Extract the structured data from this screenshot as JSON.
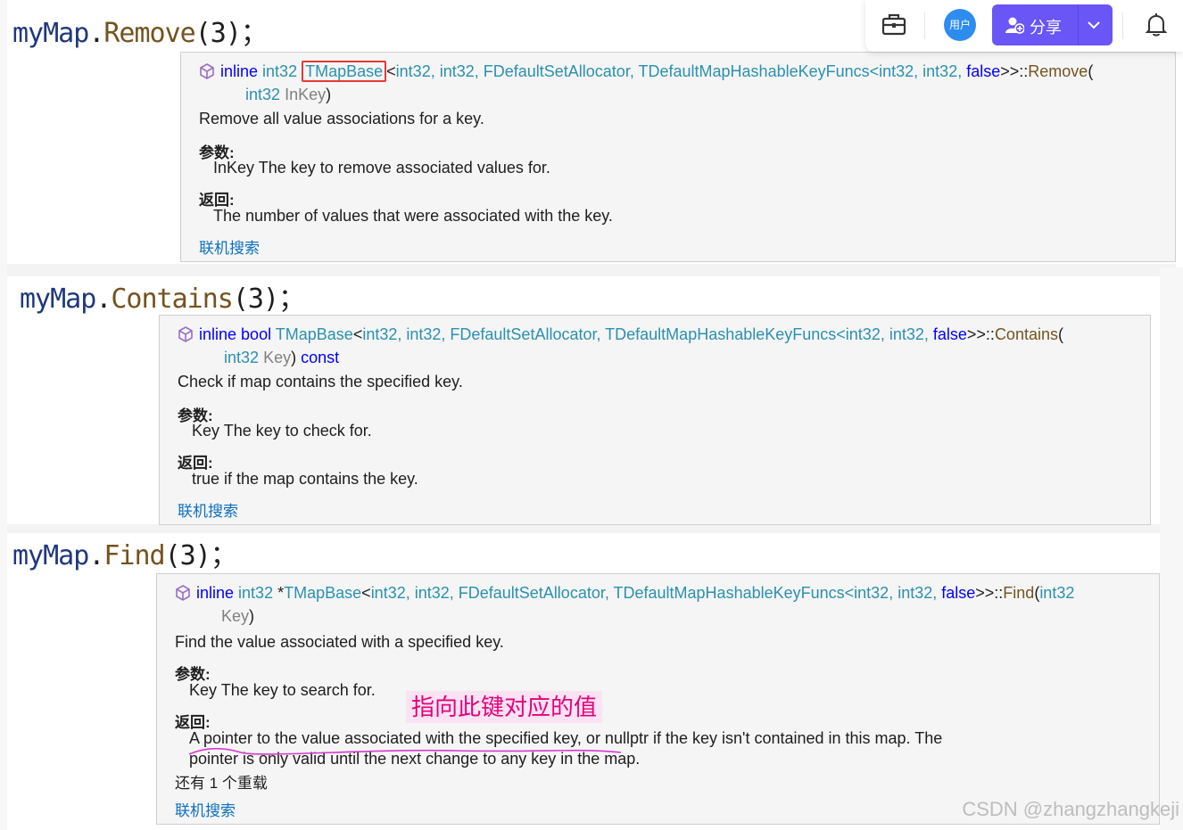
{
  "topbar": {
    "user_label": "用户",
    "share_label": "分享"
  },
  "code_lines": [
    {
      "obj": "myMap",
      "method": "Remove",
      "rest": "(3)；"
    },
    {
      "obj": "myMap",
      "method": "Contains",
      "rest": "(3)；"
    },
    {
      "obj": "myMap",
      "method": "Find",
      "rest": "(3)；"
    }
  ],
  "tooltips": [
    {
      "sig": {
        "kw1": "inline",
        "ret": "int32",
        "cls": "TMapBase",
        "lt": "<",
        "targs": "int32, int32, FDefaultSetAllocator, TDefaultMapHashableKeyFuncs<int32, int32, ",
        "false_kw": "false",
        "gt": ">>::",
        "fn": "Remove",
        "open": "(",
        "ptype": "int32",
        "pname": "InKey",
        "close": ")",
        "const_kw": ""
      },
      "description": "Remove all value associations for a key.",
      "params_label": "参数:",
      "params_text": "InKey The key to remove associated values for.",
      "returns_label": "返回:",
      "returns_text": "The number of values that were associated with the key.",
      "link": "联机搜索"
    },
    {
      "sig": {
        "kw1": "inline",
        "ret": "bool",
        "cls": "TMapBase",
        "lt": "<",
        "targs": "int32, int32, FDefaultSetAllocator, TDefaultMapHashableKeyFuncs<int32, int32, ",
        "false_kw": "false",
        "gt": ">>::",
        "fn": "Contains",
        "open": "(",
        "ptype": "int32",
        "pname": "Key",
        "close": ")",
        "const_kw": "const"
      },
      "description": "Check if map contains the specified key.",
      "params_label": "参数:",
      "params_text": "Key The key to check for.",
      "returns_label": "返回:",
      "returns_text": "true if the map contains the key.",
      "link": "联机搜索"
    },
    {
      "sig": {
        "kw1": "inline",
        "ret": "int32",
        "ptr": "*",
        "cls": "TMapBase",
        "lt": "<",
        "targs": "int32, int32, FDefaultSetAllocator, TDefaultMapHashableKeyFuncs<int32, int32, ",
        "false_kw": "false",
        "gt": ">>::",
        "fn": "Find",
        "open": "(",
        "ptype": "int32",
        "pname": "Key",
        "close": ")",
        "const_kw": ""
      },
      "description": "Find the value associated with a specified key.",
      "params_label": "参数:",
      "params_text": "Key The key to search for.",
      "returns_label": "返回:",
      "returns_text_1": "A pointer to the value associated with the specified key, or nullptr if the key isn't contained in this map. The",
      "returns_text_2": "pointer is only valid until the next change to any key in the map.",
      "overloads": "还有 1 个重载",
      "link": "联机搜索"
    }
  ],
  "annotation": "指向此键对应的值",
  "watermark": "CSDN @zhangzhangkeji",
  "colors": {
    "keyword": "#0000ff",
    "type": "#2b91af",
    "function": "#74531f",
    "link": "#0e70c0",
    "highlight_box": "#e53935",
    "annotation_text": "#e6007a",
    "annotation_bg": "#fbe3f3",
    "share_button": "#6a55f6"
  }
}
